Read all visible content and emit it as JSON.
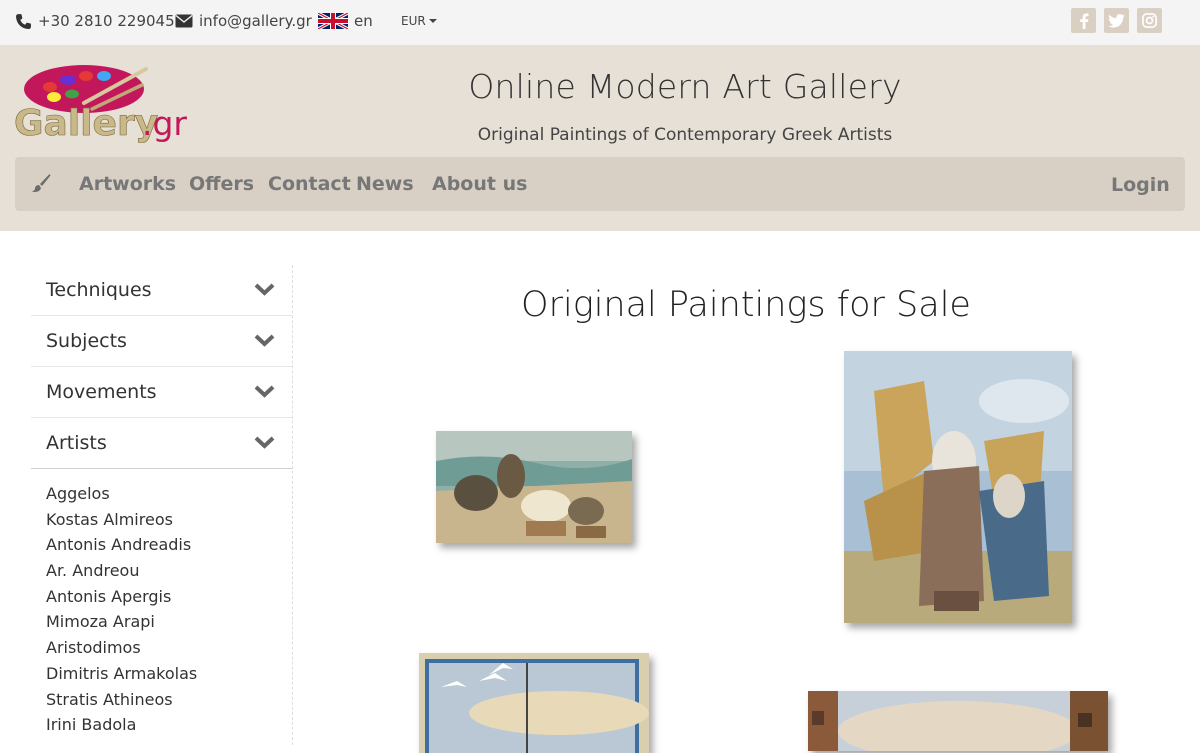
{
  "topbar": {
    "phone": "+30 2810 229045",
    "email": "info@gallery.gr",
    "language": "en",
    "currency": "EUR",
    "phone_icon": "phone-icon",
    "email_icon": "envelope-icon",
    "flag_icon": "uk-flag-icon",
    "social": [
      "facebook-icon",
      "twitter-icon",
      "instagram-icon"
    ]
  },
  "header": {
    "title": "Online Modern Art Gallery",
    "subtitle": "Original Paintings of Contemporary Greek Artists",
    "logo_text": "Gallery.gr"
  },
  "nav": {
    "items": [
      "Artworks",
      "Offers",
      "Contact",
      "News",
      "About us"
    ],
    "login": "Login",
    "home_icon": "paintbrush-icon"
  },
  "sidebar": {
    "facets": [
      "Techniques",
      "Subjects",
      "Movements",
      "Artists"
    ],
    "artists": [
      "Aggelos",
      "Kostas Almireos",
      "Antonis Andreadis",
      "Ar. Andreou",
      "Antonis Apergis",
      "Mimoza Arapi",
      "Aristodimos",
      "Dimitris Armakolas",
      "Stratis Athineos",
      "Irini Badola"
    ]
  },
  "main": {
    "title": "Original Paintings for Sale"
  },
  "colors": {
    "topbar_bg": "#f4f4f4",
    "header_bg": "#e7e0d6",
    "nav_bg": "#d8d0c5",
    "social_bg": "#d9cfc2",
    "logo_pink": "#c2185b"
  }
}
